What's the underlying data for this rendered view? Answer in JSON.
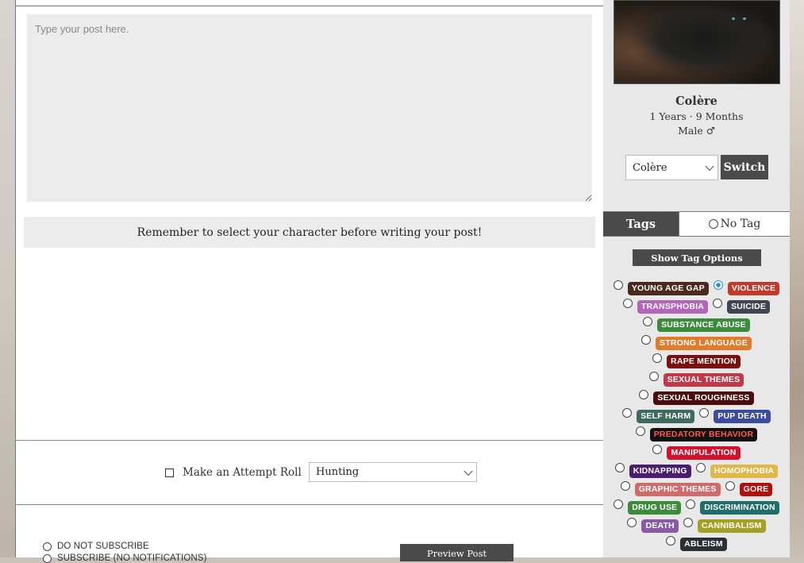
{
  "editor": {
    "placeholder": "Type your post here.",
    "reminder": "Remember to select your character before writing your post!"
  },
  "attempt_roll": {
    "label": "Make an Attempt Roll",
    "checked": false,
    "selected": "Hunting"
  },
  "subscribe": {
    "options": [
      "DO NOT SUBSCRIBE",
      "SUBSCRIBE (NO NOTIFICATIONS)"
    ]
  },
  "preview_button": "Preview Post",
  "character": {
    "name": "Colère",
    "age": "1 Years · 9 Months",
    "sex": "Male ♂",
    "selected": "Colère",
    "switch_label": "Switch"
  },
  "tags_panel": {
    "tab_label": "Tags",
    "no_tag_label": "No Tag",
    "show_options_label": "Show Tag Options",
    "rows": [
      [
        {
          "label": "YOUNG AGE GAP",
          "color": "#4a2a1c",
          "text_color": "#ffffff",
          "checked": false
        },
        {
          "label": "VIOLENCE",
          "color": "#c0392b",
          "text_color": "#ffffff",
          "checked": true
        }
      ],
      [
        {
          "label": "TRANSPHOBIA",
          "color": "#b565b8",
          "text_color": "#ffffff",
          "checked": false
        },
        {
          "label": "SUICIDE",
          "color": "#3f4650",
          "text_color": "#ffffff",
          "checked": false
        }
      ],
      [
        {
          "label": "SUBSTANCE ABUSE",
          "color": "#3d8b3d",
          "text_color": "#ffffff",
          "checked": false
        }
      ],
      [
        {
          "label": "STRONG LANGUAGE",
          "color": "#e07b2c",
          "text_color": "#ffffff",
          "checked": false
        }
      ],
      [
        {
          "label": "RAPE MENTION",
          "color": "#7a0f0f",
          "text_color": "#ffffff",
          "checked": false
        }
      ],
      [
        {
          "label": "SEXUAL THEMES",
          "color": "#c0394b",
          "text_color": "#ffffff",
          "checked": false
        }
      ],
      [
        {
          "label": "SEXUAL ROUGHNESS",
          "color": "#4a0d0d",
          "text_color": "#ffffff",
          "checked": false
        }
      ],
      [
        {
          "label": "SELF HARM",
          "color": "#3f6b5f",
          "text_color": "#ffffff",
          "checked": false
        },
        {
          "label": "PUP DEATH",
          "color": "#3c4d9e",
          "text_color": "#ffffff",
          "checked": false
        }
      ],
      [
        {
          "label": "PREDATORY BEHAVIOR",
          "color": "#111111",
          "text_color": "#ff5a4a",
          "checked": false
        }
      ],
      [
        {
          "label": "MANIPULATION",
          "color": "#d1122f",
          "text_color": "#ffffff",
          "checked": false
        }
      ],
      [
        {
          "label": "KIDNAPPING",
          "color": "#4a1d6e",
          "text_color": "#ffffff",
          "checked": false
        },
        {
          "label": "HOMOPHOBIA",
          "color": "#e0b84a",
          "text_color": "#ffffff",
          "checked": false
        }
      ],
      [
        {
          "label": "GRAPHIC THEMES",
          "color": "#d06b6b",
          "text_color": "#ffffff",
          "checked": false
        },
        {
          "label": "GORE",
          "color": "#b30f0f",
          "text_color": "#ffffff",
          "checked": false
        }
      ],
      [
        {
          "label": "DRUG USE",
          "color": "#3d8b3d",
          "text_color": "#ffffff",
          "checked": false
        },
        {
          "label": "DISCRIMINATION",
          "color": "#1f6e6a",
          "text_color": "#ffffff",
          "checked": false
        }
      ],
      [
        {
          "label": "DEATH",
          "color": "#8a5aa8",
          "text_color": "#ffffff",
          "checked": false
        },
        {
          "label": "CANNIBALISM",
          "color": "#a3a124",
          "text_color": "#ffffff",
          "checked": false
        }
      ],
      [
        {
          "label": "ABLEISM",
          "color": "#2b2f36",
          "text_color": "#ffffff",
          "checked": false
        }
      ]
    ]
  }
}
